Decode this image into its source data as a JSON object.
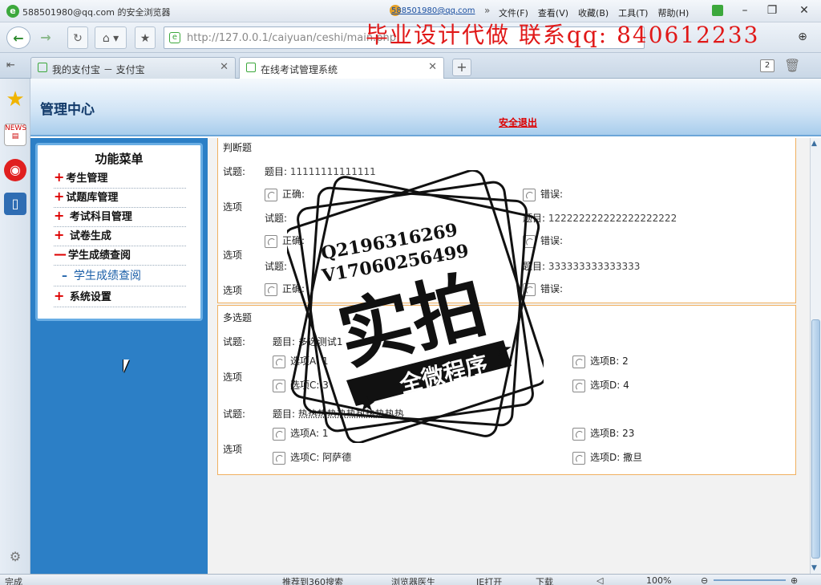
{
  "window": {
    "title": "588501980@qq.com 的安全浏览器",
    "user": "588501980@qq.com",
    "menus": [
      "文件(F)",
      "查看(V)",
      "收藏(B)",
      "工具(T)",
      "帮助(H)"
    ]
  },
  "address": {
    "url": "http://127.0.0.1/caiyuan/ceshi/main.php"
  },
  "overlay_ad": "毕业设计代做 联系qq: 840612233",
  "tabs": [
    {
      "label": "我的支付宝 － 支付宝",
      "active": false
    },
    {
      "label": "在线考试管理系统",
      "active": true
    }
  ],
  "tab_count": "2",
  "page": {
    "header_title": "管理中心",
    "logout": "安全退出"
  },
  "menu": {
    "title": "功能菜单",
    "items": [
      {
        "mark": "+",
        "label": "考生管理"
      },
      {
        "mark": "+",
        "label": "试题库管理"
      },
      {
        "mark": "+",
        "label": " 考试科目管理"
      },
      {
        "mark": "+",
        "label": " 试卷生成"
      },
      {
        "mark": "—",
        "label": "学生成绩查阅"
      },
      {
        "mark": "–",
        "label": "学生成绩查阅"
      },
      {
        "mark": "+",
        "label": " 系统设置"
      }
    ]
  },
  "exam": {
    "judge": {
      "section_title": "判断题",
      "question_label": "试题:",
      "option_label": "选项",
      "prefix": "题目:",
      "questions": [
        {
          "text": "11111111111111",
          "opt_true": "正确:",
          "opt_false": "错误:"
        },
        {
          "text": "122222222222222222222",
          "opt_true": "正确:",
          "opt_false": "错误:"
        },
        {
          "text": "333333333333333",
          "opt_true": "正确:",
          "opt_false": "错误:"
        }
      ]
    },
    "multi": {
      "section_title": "多选题",
      "question_label": "试题:",
      "option_label": "选项",
      "prefix": "题目:",
      "questions": [
        {
          "text": "多选测试1",
          "a": "选项A:  1",
          "b": "选项B:  2",
          "c": "选项C:  3",
          "d": "选项D:  4"
        },
        {
          "text": "热热热热热热热热热热热",
          "a": "选项A:  1",
          "b": "选项B:  23",
          "c": "选项C:  阿萨德",
          "d": "选项D:  撒旦"
        }
      ]
    }
  },
  "stamp": {
    "line1": "Q2196316269",
    "line2": "V17060256499",
    "big": "实拍",
    "banner": "全微程序"
  },
  "status": {
    "left": "完成",
    "recommend": "推荐到360搜索",
    "doctor": "浏览器医生",
    "ie": "IE打开",
    "download": "下载",
    "zoom": "100%"
  },
  "colors": {
    "accent_blue": "#2c7fc6",
    "danger_red": "#dd0000",
    "frame_orange": "#f0b060"
  }
}
